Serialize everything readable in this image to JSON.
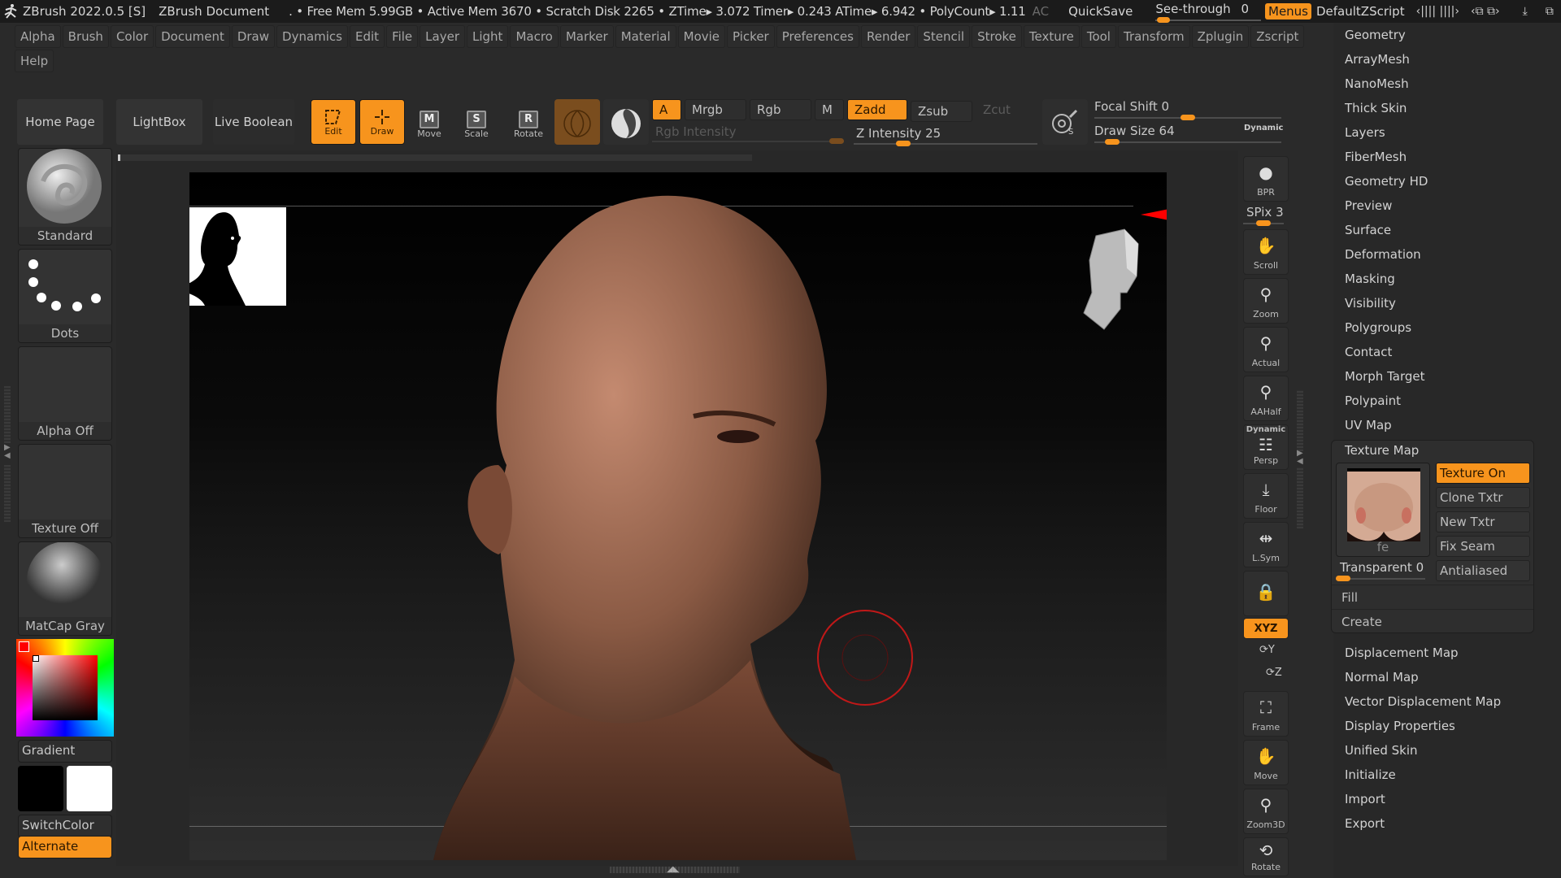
{
  "titlebar": {
    "app": "ZBrush 2022.0.5 [S]",
    "document": "ZBrush Document",
    "stats": ". • Free Mem 5.99GB • Active Mem 3670 • Scratch Disk 2265 •  ZTime▸ 3.072 Timer▸ 0.243 ATime▸ 6.942 • PolyCount▸ 1.11",
    "ac": "AC",
    "quicksave": "QuickSave",
    "see_through_label": "See-through",
    "see_through_value": "0",
    "see_through_fraction": 0,
    "menus": "Menus",
    "script": "DefaultZScript",
    "window_icons": [
      "‹|||| ||||›",
      "‹⧉ ⧉›",
      "⤓",
      "⧉",
      "✕"
    ]
  },
  "menubar": {
    "items": [
      "Alpha",
      "Brush",
      "Color",
      "Document",
      "Draw",
      "Dynamics",
      "Edit",
      "File",
      "Layer",
      "Light",
      "Macro",
      "Marker",
      "Material",
      "Movie",
      "Picker",
      "Preferences",
      "Render",
      "Stencil",
      "Stroke",
      "Texture",
      "Tool",
      "Transform",
      "Zplugin",
      "Zscript",
      "Help"
    ]
  },
  "shelf": {
    "home_page": "Home Page",
    "lightbox": "LightBox",
    "live_boolean": "Live Boolean",
    "edit": "Edit",
    "draw": "Draw",
    "move": "Move",
    "scale": "Scale",
    "rotate": "Rotate",
    "move_glyph": "M",
    "scale_glyph": "S",
    "rotate_glyph": "R",
    "a": "A",
    "mrgb": "Mrgb",
    "rgb": "Rgb",
    "m": "M",
    "zadd": "Zadd",
    "zsub": "Zsub",
    "zcut": "Zcut",
    "rgb_intensity": "Rgb Intensity",
    "z_intensity_label": "Z Intensity",
    "z_intensity_value": "25",
    "z_intensity_fraction": 0.25,
    "focal_shift_label": "Focal Shift",
    "focal_shift_value": "0",
    "focal_shift_fraction": 0.5,
    "draw_size_label": "Draw Size",
    "draw_size_value": "64",
    "draw_size_fraction": 0.06,
    "dynamic": "Dynamic"
  },
  "lefttray": {
    "brush": "Standard",
    "stroke": "Dots",
    "alpha": "Alpha Off",
    "texture": "Texture Off",
    "material": "MatCap Gray",
    "gradient": "Gradient",
    "switch_color": "SwitchColor",
    "alternate": "Alternate",
    "main_color": "#ff0000",
    "secondary_color": "#ffffff"
  },
  "rightshelf": {
    "bpr": "BPR",
    "spix_label": "SPix",
    "spix_value": "3",
    "scroll": "Scroll",
    "zoom": "Zoom",
    "actual": "Actual",
    "aahalf": "AAHalf",
    "dynamic": "Dynamic",
    "persp": "Persp",
    "floor": "Floor",
    "lsym": "L.Sym",
    "xyz": "XYZ",
    "y": "Y",
    "z": "Z",
    "frame": "Frame",
    "move": "Move",
    "zoom3d": "Zoom3D",
    "rotate": "Rotate"
  },
  "palette": {
    "items_top": [
      "Geometry",
      "ArrayMesh",
      "NanoMesh",
      "Thick Skin",
      "Layers",
      "FiberMesh",
      "Geometry HD",
      "Preview",
      "Surface",
      "Deformation",
      "Masking",
      "Visibility",
      "Polygroups",
      "Contact",
      "Morph Target",
      "Polypaint",
      "UV Map"
    ],
    "texture_map": {
      "title": "Texture Map",
      "thumb_label": "fe",
      "texture_on": "Texture On",
      "clone_txtr": "Clone Txtr",
      "new_txtr": "New Txtr",
      "fix_seam": "Fix Seam",
      "transparent_label": "Transparent",
      "transparent_value": "0",
      "antialiased": "Antialiased",
      "fill": "Fill",
      "create": "Create"
    },
    "items_bottom": [
      "Displacement Map",
      "Normal Map",
      "Vector Displacement Map",
      "Display Properties",
      "Unified Skin",
      "Initialize",
      "Import",
      "Export"
    ]
  },
  "colors": {
    "accent": "#f7941d",
    "bg": "#2a2a2a",
    "titlebar": "#1b1b1b"
  }
}
